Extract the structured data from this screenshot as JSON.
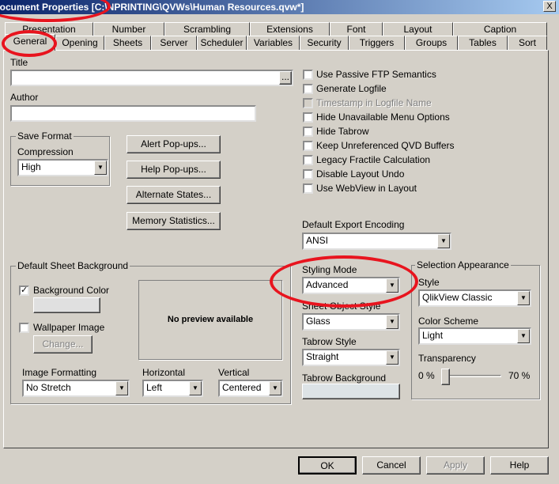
{
  "window": {
    "title": "Document Properties [C:\\NPRINTING\\QVWs\\Human Resources.qvw*]",
    "close": "X"
  },
  "tabs_row1": [
    "Presentation",
    "Number",
    "Scrambling",
    "Extensions",
    "Font",
    "Layout",
    "Caption"
  ],
  "tabs_row2": [
    "General",
    "Opening",
    "Sheets",
    "Server",
    "Scheduler",
    "Variables",
    "Security",
    "Triggers",
    "Groups",
    "Tables",
    "Sort"
  ],
  "general": {
    "title_label": "Title",
    "title_value": "",
    "title_browse": "...",
    "author_label": "Author",
    "author_value": "",
    "save_format": {
      "legend": "Save Format",
      "compression_label": "Compression",
      "compression_value": "High"
    },
    "buttons": {
      "alert": "Alert Pop-ups...",
      "help_popups": "Help Pop-ups...",
      "alternate": "Alternate States...",
      "memory": "Memory Statistics..."
    },
    "checkboxes": [
      {
        "label": "Use Passive FTP Semantics",
        "checked": false,
        "enabled": true
      },
      {
        "label": "Generate Logfile",
        "checked": false,
        "enabled": true
      },
      {
        "label": "Timestamp in Logfile Name",
        "checked": false,
        "enabled": false
      },
      {
        "label": "Hide Unavailable Menu Options",
        "checked": false,
        "enabled": true
      },
      {
        "label": "Hide Tabrow",
        "checked": false,
        "enabled": true
      },
      {
        "label": "Keep Unreferenced QVD Buffers",
        "checked": false,
        "enabled": true
      },
      {
        "label": "Legacy Fractile Calculation",
        "checked": false,
        "enabled": true
      },
      {
        "label": "Disable Layout Undo",
        "checked": false,
        "enabled": true
      },
      {
        "label": "Use WebView in Layout",
        "checked": false,
        "enabled": true
      }
    ],
    "export_encoding_label": "Default Export Encoding",
    "export_encoding_value": "ANSI",
    "sheet_bg": {
      "legend": "Default Sheet Background",
      "bg_color_label": "Background Color",
      "bg_color_checked": true,
      "wallpaper_label": "Wallpaper Image",
      "wallpaper_checked": false,
      "change": "Change...",
      "preview": "No preview available",
      "image_formatting_label": "Image Formatting",
      "image_formatting_value": "No Stretch",
      "horizontal_label": "Horizontal",
      "horizontal_value": "Left",
      "vertical_label": "Vertical",
      "vertical_value": "Centered"
    },
    "styling_mode_label": "Styling Mode",
    "styling_mode_value": "Advanced",
    "sheet_object_style_label": "Sheet Object Style",
    "sheet_object_style_value": "Glass",
    "tabrow_style_label": "Tabrow Style",
    "tabrow_style_value": "Straight",
    "tabrow_bg_label": "Tabrow Background",
    "selection": {
      "legend": "Selection Appearance",
      "style_label": "Style",
      "style_value": "QlikView Classic",
      "color_scheme_label": "Color Scheme",
      "color_scheme_value": "Light",
      "transparency_label": "Transparency",
      "min": "0 %",
      "max": "70 %",
      "transparency_value": 0
    }
  },
  "footer": {
    "ok": "OK",
    "cancel": "Cancel",
    "apply": "Apply",
    "help": "Help"
  },
  "colors": {
    "annotation": "#e8141e",
    "bg": "#d4d0c8"
  }
}
